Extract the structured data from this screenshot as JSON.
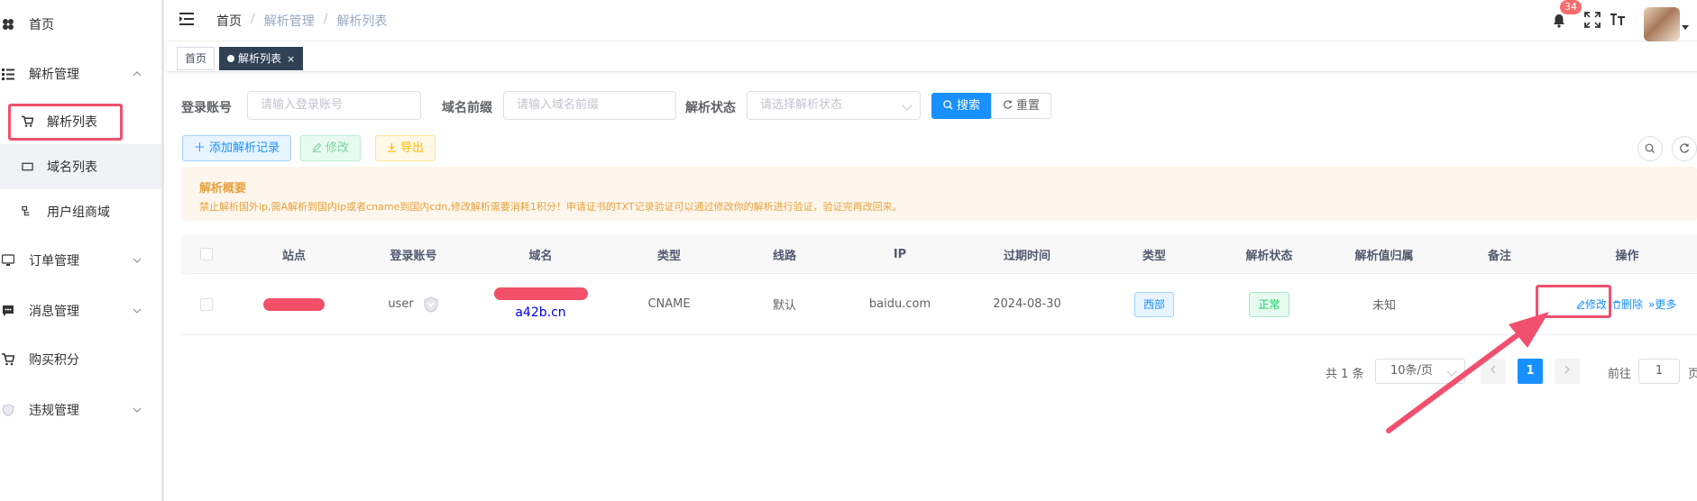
{
  "sidebar": {
    "items": [
      {
        "label": "首页",
        "icon": "dashboard-icon"
      },
      {
        "label": "解析管理",
        "icon": "list-icon",
        "expanded": true,
        "children": [
          {
            "label": "解析列表",
            "icon": "cart-icon",
            "active": true
          },
          {
            "label": "域名列表",
            "icon": "rectangle-icon"
          },
          {
            "label": "用户组商域",
            "icon": "tree-icon"
          }
        ]
      },
      {
        "label": "订单管理",
        "icon": "monitor-icon"
      },
      {
        "label": "消息管理",
        "icon": "message-icon"
      },
      {
        "label": "购买积分",
        "icon": "cart-icon"
      },
      {
        "label": "违规管理",
        "icon": "shield-icon"
      }
    ]
  },
  "header": {
    "breadcrumb": [
      "首页",
      "解析管理",
      "解析列表"
    ],
    "notification_count": "34"
  },
  "tags": {
    "home": "首页",
    "active": "解析列表",
    "close": "×"
  },
  "search": {
    "account_label": "登录账号",
    "account_placeholder": "请输入登录账号",
    "prefix_label": "域名前缀",
    "prefix_placeholder": "请输入域名前缀",
    "status_label": "解析状态",
    "status_placeholder": "请选择解析状态",
    "search_btn": "搜索",
    "reset_btn": "重置"
  },
  "toolbar": {
    "add": "添加解析记录",
    "edit": "修改",
    "export": "导出"
  },
  "alert": {
    "title": "解析概要",
    "desc": "禁止解析国外ip,需A解析到国内ip或者cname到国内cdn,修改解析需要消耗1积分！申请证书的TXT记录验证可以通过修改你的解析进行验证，验证完再改回来。"
  },
  "table": {
    "columns": [
      "站点",
      "登录账号",
      "域名",
      "类型",
      "线路",
      "IP",
      "过期时间",
      "类型",
      "解析状态",
      "解析值归属",
      "备注",
      "操作"
    ],
    "rows": [
      {
        "account": "user",
        "domain": "a42b.cn",
        "type": "CNAME",
        "line": "默认",
        "ip": "baidu.com",
        "expire": "2024-08-30",
        "region": "西部",
        "status": "正常",
        "owner": "未知",
        "note": "",
        "ops": {
          "edit": "修改",
          "delete": "删除",
          "more": "更多"
        }
      }
    ]
  },
  "pagination": {
    "total": "共 1 条",
    "page_size": "10条/页",
    "current": "1",
    "goto_prefix": "前往",
    "goto_value": "1",
    "goto_suffix": "页"
  },
  "colors": {
    "primary": "#1890ff",
    "highlight": "#f0506e",
    "sidebar_active_bg": "#f0f2f5"
  }
}
